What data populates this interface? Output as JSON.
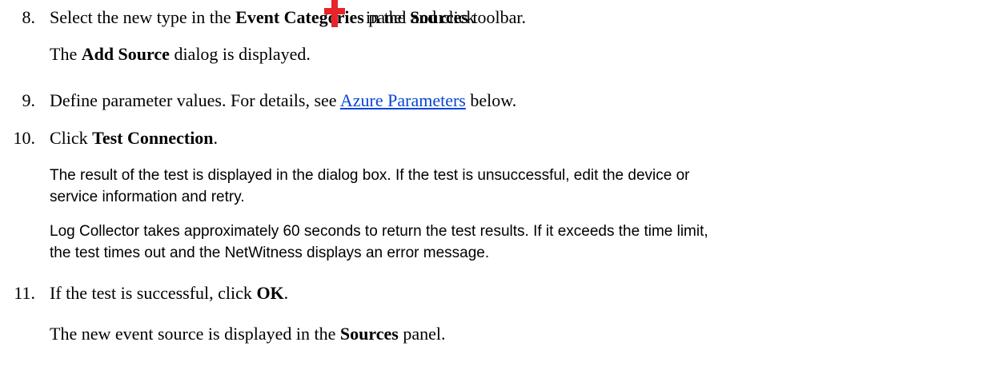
{
  "steps": [
    {
      "number": "8.",
      "text_before": "Select the new type in the ",
      "bold1": "Event Categories",
      "text_mid": " panel and click ",
      "icon": "red-plus-icon",
      "text_mid2": " in the ",
      "bold2": "Sources",
      "text_after": " toolbar.",
      "result_before": "The ",
      "result_bold": "Add Source",
      "result_after": " dialog is displayed."
    },
    {
      "number": "9.",
      "text_before": "Define parameter values. For details, see ",
      "link": "Azure Parameters",
      "text_after": " below."
    },
    {
      "number": "10.",
      "text_before": "Click ",
      "bold1": "Test Connection",
      "text_after": ".",
      "para1_line1": "The result of the test is displayed in the dialog box. If the test is unsuccessful, edit the device or",
      "para1_line2": "service information and retry.",
      "para2_line1": "Log Collector takes approximately 60 seconds to return the test results. If it exceeds the time limit,",
      "para2_line2": "the test times out and the NetWitness displays an error message."
    },
    {
      "number": "11.",
      "text_before": "If the test is successful, click ",
      "bold1": "OK",
      "text_after": ".",
      "result_before": "The new event source is displayed in the ",
      "result_bold": "Sources",
      "result_after": " panel."
    }
  ],
  "colors": {
    "link": "#0645d6",
    "plus_icon": "#e8232a"
  }
}
